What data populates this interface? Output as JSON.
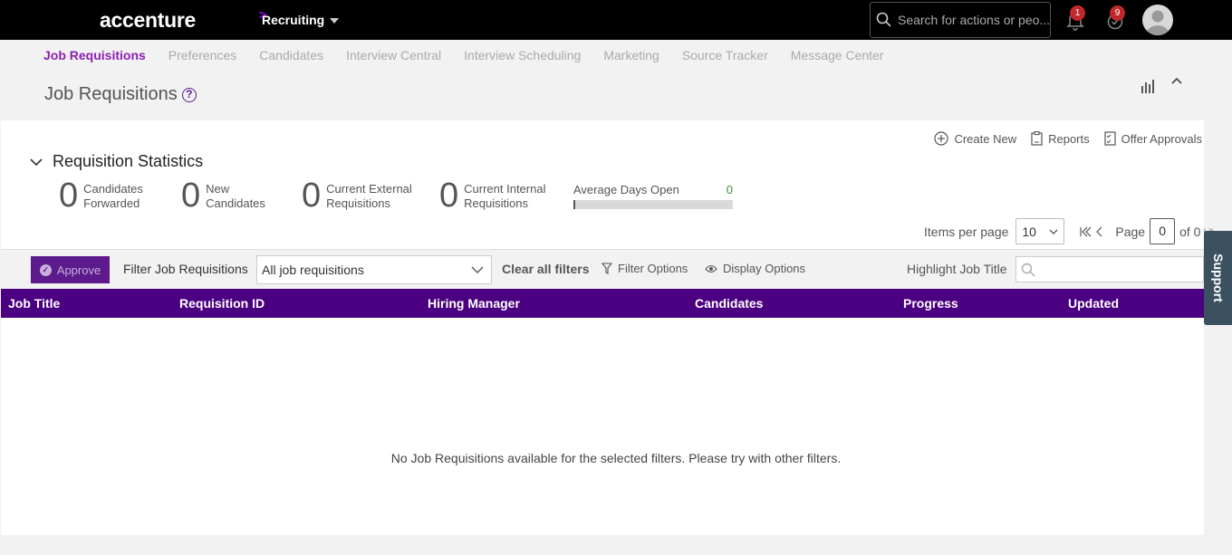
{
  "topbar": {
    "logo": "accenture",
    "module": "Recruiting",
    "search_placeholder": "Search for actions or peo...",
    "notifications_count": "1",
    "approvals_count": "9"
  },
  "nav": {
    "tabs": [
      {
        "label": "Job Requisitions",
        "active": true
      },
      {
        "label": "Preferences"
      },
      {
        "label": "Candidates"
      },
      {
        "label": "Interview Central"
      },
      {
        "label": "Interview Scheduling"
      },
      {
        "label": "Marketing"
      },
      {
        "label": "Source Tracker"
      },
      {
        "label": "Message Center"
      }
    ]
  },
  "page": {
    "title": "Job Requisitions",
    "help_glyph": "?"
  },
  "actions": {
    "create_new": "Create New",
    "reports": "Reports",
    "offer_approvals": "Offer Approvals"
  },
  "stats": {
    "header": "Requisition Statistics",
    "items": [
      {
        "value": "0",
        "label": "Candidates\nForwarded"
      },
      {
        "value": "0",
        "label": "New\nCandidates"
      },
      {
        "value": "0",
        "label": "Current External\nRequisitions"
      },
      {
        "value": "0",
        "label": "Current Internal\nRequisitions"
      }
    ],
    "avg_days_label": "Average Days Open",
    "avg_days_value": "0"
  },
  "paging": {
    "items_per_page_label": "Items per page",
    "items_per_page": "10",
    "page_label": "Page",
    "page_value": "0",
    "of_label": "of 0"
  },
  "filters": {
    "approve": "Approve",
    "filter_label": "Filter Job Requisitions",
    "filter_value": "All job requisitions",
    "clear_all": "Clear all filters",
    "filter_options": "Filter Options",
    "display_options": "Display Options",
    "highlight_label": "Highlight Job Title",
    "highlight_value": ""
  },
  "table": {
    "columns": [
      "Job Title",
      "Requisition ID",
      "Hiring Manager",
      "Candidates",
      "Progress",
      "Updated"
    ],
    "empty_message": "No Job Requisitions available for the selected filters. Please try with other filters."
  },
  "support": "Support",
  "colors": {
    "accent_purple": "#4b0082",
    "active_tab": "#8a1fb3",
    "badge_red": "#c0292b"
  }
}
